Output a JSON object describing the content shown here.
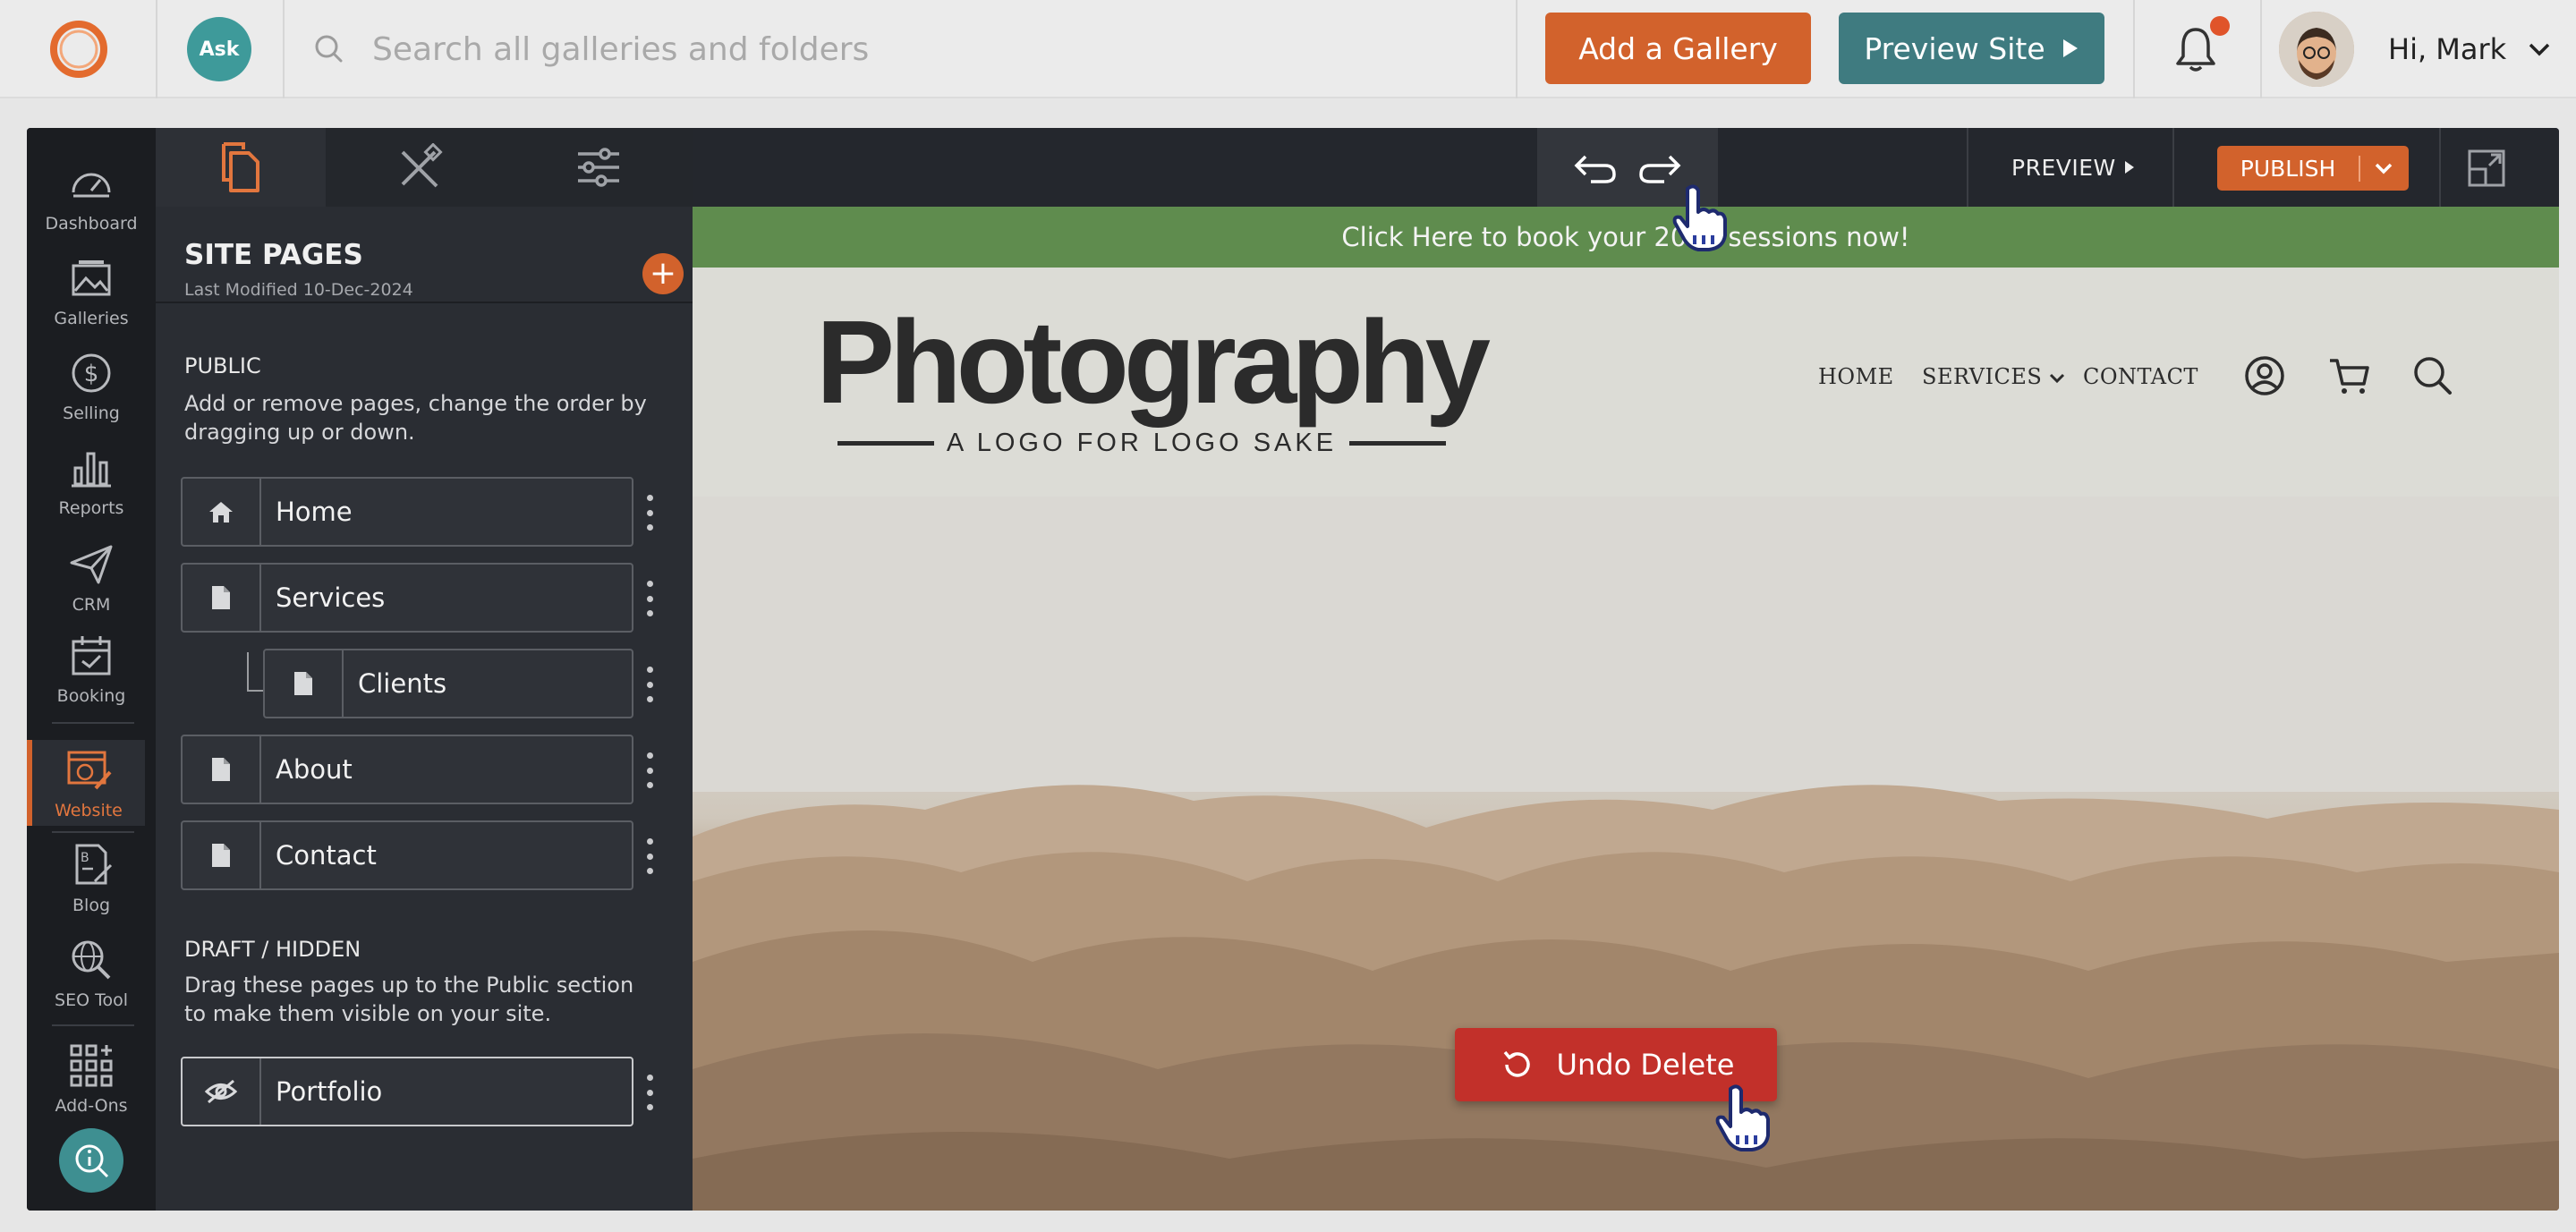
{
  "header": {
    "search_placeholder": "Search all galleries and folders",
    "add_gallery_label": "Add a Gallery",
    "preview_site_label": "Preview Site",
    "user_greeting": "Hi, Mark",
    "ask_label": "Ask"
  },
  "rail": {
    "items": [
      {
        "label": "Dashboard",
        "icon": "dashboard-icon"
      },
      {
        "label": "Galleries",
        "icon": "galleries-icon"
      },
      {
        "label": "Selling",
        "icon": "selling-icon"
      },
      {
        "label": "Reports",
        "icon": "reports-icon"
      },
      {
        "label": "CRM",
        "icon": "crm-icon"
      },
      {
        "label": "Booking",
        "icon": "booking-icon"
      },
      {
        "label": "Website",
        "icon": "website-icon",
        "active": true
      },
      {
        "label": "Blog",
        "icon": "blog-icon"
      },
      {
        "label": "SEO Tool",
        "icon": "seo-icon"
      },
      {
        "label": "Add-Ons",
        "icon": "addons-icon"
      }
    ]
  },
  "panel": {
    "title": "SITE PAGES",
    "last_modified": "Last Modified 10-Dec-2024",
    "public": {
      "title": "PUBLIC",
      "description": "Add or remove pages, change the order by dragging up or down.",
      "pages": [
        "Home",
        "Services",
        "Clients",
        "About",
        "Contact"
      ]
    },
    "draft": {
      "title": "DRAFT / HIDDEN",
      "description": "Drag these pages up to the Public section to make them visible on your site.",
      "pages": [
        "Portfolio"
      ]
    }
  },
  "toolbar": {
    "preview_label": "PREVIEW",
    "publish_label": "PUBLISH"
  },
  "site": {
    "announcement": "Click Here to book your 2025 sessions now!",
    "logo_word": "Photography",
    "logo_tagline": "A LOGO FOR LOGO SAKE",
    "nav": [
      "HOME",
      "SERVICES",
      "CONTACT"
    ]
  },
  "toast": {
    "undo_label": "Undo Delete"
  },
  "colors": {
    "accent": "#d2622c",
    "teal": "#3f7b80",
    "announce_bar": "#5f8c4e",
    "toast": "#c2302a"
  }
}
